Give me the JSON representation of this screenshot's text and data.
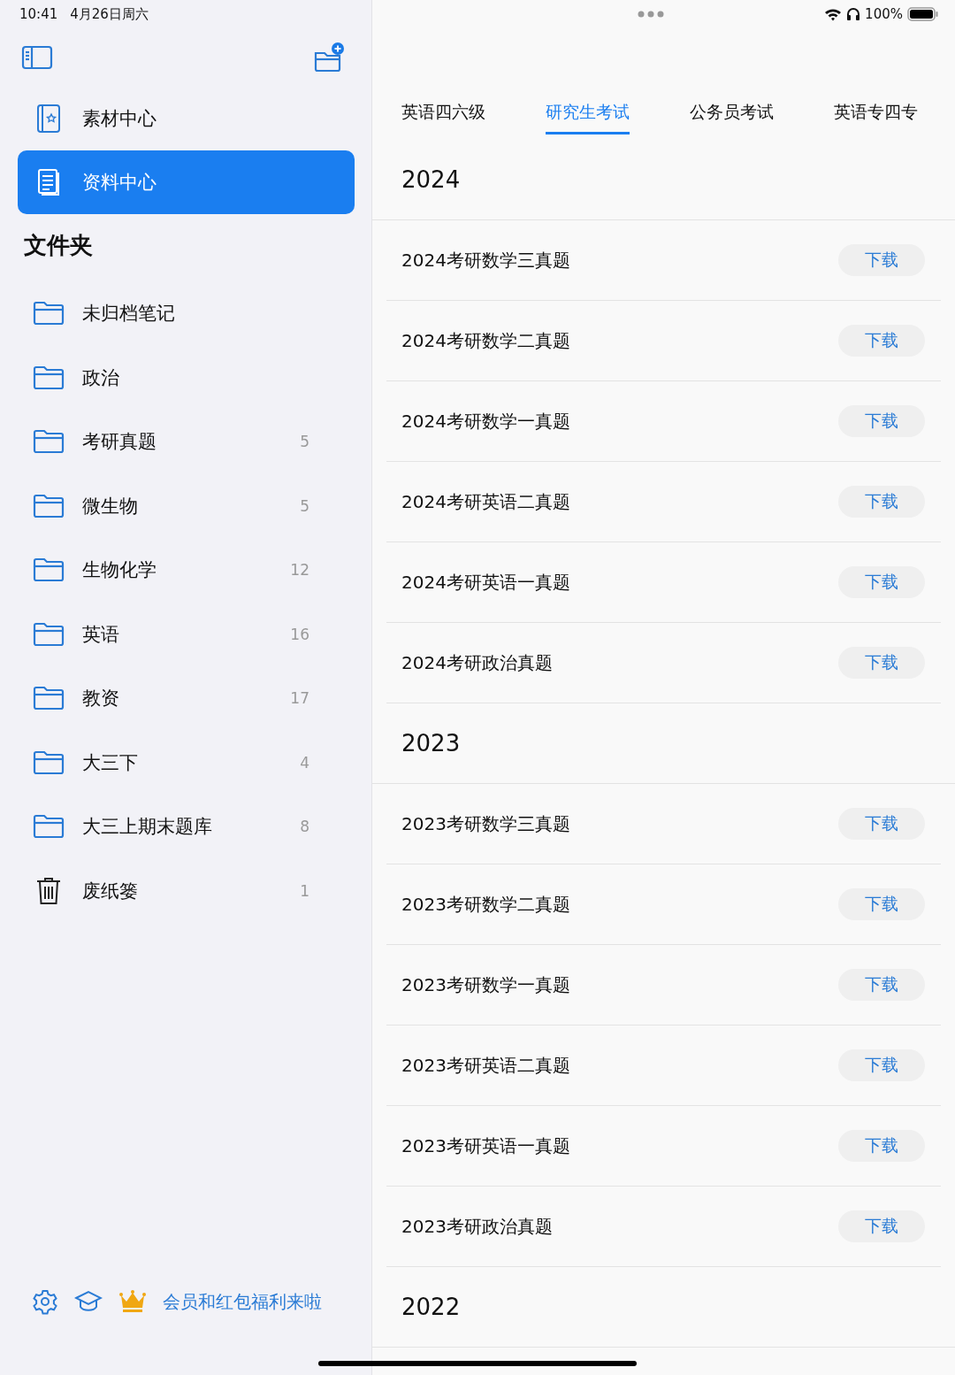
{
  "status_bar": {
    "time": "10:41",
    "date": "4月26日周六",
    "battery": "100%"
  },
  "sidebar": {
    "nav": [
      {
        "label": "素材中心",
        "kind": "star-book",
        "selected": false
      },
      {
        "label": "资料中心",
        "kind": "document",
        "selected": true
      }
    ],
    "folders_title": "文件夹",
    "folders": [
      {
        "label": "未归档笔记",
        "kind": "folder"
      },
      {
        "label": "政治",
        "kind": "folder"
      },
      {
        "label": "考研真题",
        "kind": "folder",
        "count": "5"
      },
      {
        "label": "微生物",
        "kind": "folder",
        "count": "5"
      },
      {
        "label": "生物化学",
        "kind": "folder",
        "count": "12"
      },
      {
        "label": "英语",
        "kind": "folder",
        "count": "16"
      },
      {
        "label": "教资",
        "kind": "folder",
        "count": "17"
      },
      {
        "label": "大三下",
        "kind": "folder",
        "count": "4"
      },
      {
        "label": "大三上期末题库",
        "kind": "folder",
        "count": "8"
      },
      {
        "label": "废纸篓",
        "kind": "trash",
        "count": "1"
      }
    ],
    "promo": "会员和红包福利来啦"
  },
  "tabs": [
    {
      "label": "英语四六级",
      "selected": false
    },
    {
      "label": "研究生考试",
      "selected": true
    },
    {
      "label": "公务员考试",
      "selected": false
    },
    {
      "label": "英语专四专",
      "selected": false
    }
  ],
  "sections": [
    {
      "year": "2024",
      "items": [
        {
          "title": "2024考研数学三真题",
          "action": "下载"
        },
        {
          "title": "2024考研数学二真题",
          "action": "下载"
        },
        {
          "title": "2024考研数学一真题",
          "action": "下载"
        },
        {
          "title": "2024考研英语二真题",
          "action": "下载"
        },
        {
          "title": "2024考研英语一真题",
          "action": "下载"
        },
        {
          "title": "2024考研政治真题",
          "action": "下载"
        }
      ]
    },
    {
      "year": "2023",
      "items": [
        {
          "title": "2023考研数学三真题",
          "action": "下载"
        },
        {
          "title": "2023考研数学二真题",
          "action": "下载"
        },
        {
          "title": "2023考研数学一真题",
          "action": "下载"
        },
        {
          "title": "2023考研英语二真题",
          "action": "下载"
        },
        {
          "title": "2023考研英语一真题",
          "action": "下载"
        },
        {
          "title": "2023考研政治真题",
          "action": "下载"
        }
      ]
    },
    {
      "year": "2022"
    }
  ]
}
